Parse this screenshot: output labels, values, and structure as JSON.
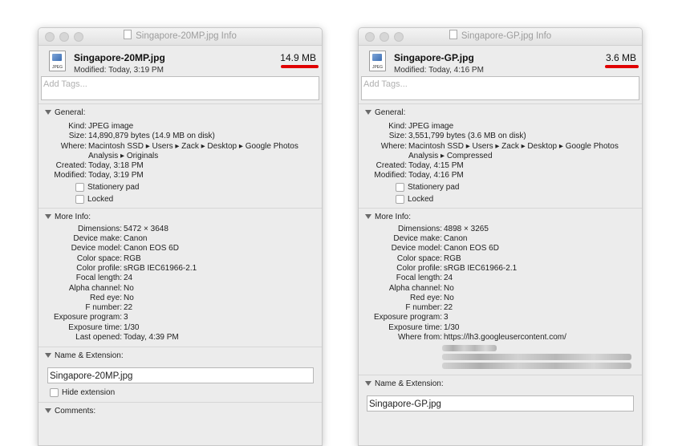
{
  "left": {
    "title": "Singapore-20MP.jpg Info",
    "file_name": "Singapore-20MP.jpg",
    "modified_line": "Modified: Today, 3:19 PM",
    "size_badge": "14.9 MB",
    "icon_label": "JPEG",
    "tags_placeholder": "Add Tags...",
    "general": {
      "header": "General:",
      "rows": [
        {
          "label": "Kind:",
          "value": "JPEG image"
        },
        {
          "label": "Size:",
          "value": "14,890,879 bytes (14.9 MB on disk)"
        },
        {
          "label": "Where:",
          "value": "Macintosh SSD ▸ Users ▸ Zack ▸ Desktop ▸ Google Photos"
        },
        {
          "label": "",
          "value": "Analysis ▸ Originals"
        },
        {
          "label": "Created:",
          "value": "Today, 3:18 PM"
        },
        {
          "label": "Modified:",
          "value": "Today, 3:19 PM"
        }
      ],
      "checks": [
        "Stationery pad",
        "Locked"
      ]
    },
    "more_info": {
      "header": "More Info:",
      "rows": [
        {
          "label": "Dimensions:",
          "value": "5472 × 3648"
        },
        {
          "label": "Device make:",
          "value": "Canon"
        },
        {
          "label": "Device model:",
          "value": "Canon EOS 6D"
        },
        {
          "label": "Color space:",
          "value": "RGB"
        },
        {
          "label": "Color profile:",
          "value": "sRGB IEC61966-2.1"
        },
        {
          "label": "Focal length:",
          "value": "24"
        },
        {
          "label": "Alpha channel:",
          "value": "No"
        },
        {
          "label": "Red eye:",
          "value": "No"
        },
        {
          "label": "F number:",
          "value": "22"
        },
        {
          "label": "Exposure program:",
          "value": "3"
        },
        {
          "label": "Exposure time:",
          "value": "1/30"
        },
        {
          "label": "Last opened:",
          "value": "Today, 4:39 PM"
        }
      ]
    },
    "name_ext": {
      "header": "Name & Extension:",
      "value": "Singapore-20MP.jpg",
      "hide_ext": "Hide extension"
    },
    "comments_header": "Comments:"
  },
  "right": {
    "title": "Singapore-GP.jpg Info",
    "file_name": "Singapore-GP.jpg",
    "modified_line": "Modified: Today, 4:16 PM",
    "size_badge": "3.6 MB",
    "icon_label": "JPEG",
    "tags_placeholder": "Add Tags...",
    "general": {
      "header": "General:",
      "rows": [
        {
          "label": "Kind:",
          "value": "JPEG image"
        },
        {
          "label": "Size:",
          "value": "3,551,799 bytes (3.6 MB on disk)"
        },
        {
          "label": "Where:",
          "value": "Macintosh SSD ▸ Users ▸ Zack ▸ Desktop ▸ Google Photos"
        },
        {
          "label": "",
          "value": "Analysis ▸ Compressed"
        },
        {
          "label": "Created:",
          "value": "Today, 4:15 PM"
        },
        {
          "label": "Modified:",
          "value": "Today, 4:16 PM"
        }
      ],
      "checks": [
        "Stationery pad",
        "Locked"
      ]
    },
    "more_info": {
      "header": "More Info:",
      "rows": [
        {
          "label": "Dimensions:",
          "value": "4898 × 3265"
        },
        {
          "label": "Device make:",
          "value": "Canon"
        },
        {
          "label": "Device model:",
          "value": "Canon EOS 6D"
        },
        {
          "label": "Color space:",
          "value": "RGB"
        },
        {
          "label": "Color profile:",
          "value": "sRGB IEC61966-2.1"
        },
        {
          "label": "Focal length:",
          "value": "24"
        },
        {
          "label": "Alpha channel:",
          "value": "No"
        },
        {
          "label": "Red eye:",
          "value": "No"
        },
        {
          "label": "F number:",
          "value": "22"
        },
        {
          "label": "Exposure program:",
          "value": "3"
        },
        {
          "label": "Exposure time:",
          "value": "1/30"
        },
        {
          "label": "Where from:",
          "value": "https://lh3.googleusercontent.com/"
        }
      ]
    },
    "name_ext": {
      "header": "Name & Extension:",
      "value": "Singapore-GP.jpg"
    }
  },
  "colors": {
    "highlight_underline": "#e00000",
    "window_bg": "#ececec"
  }
}
